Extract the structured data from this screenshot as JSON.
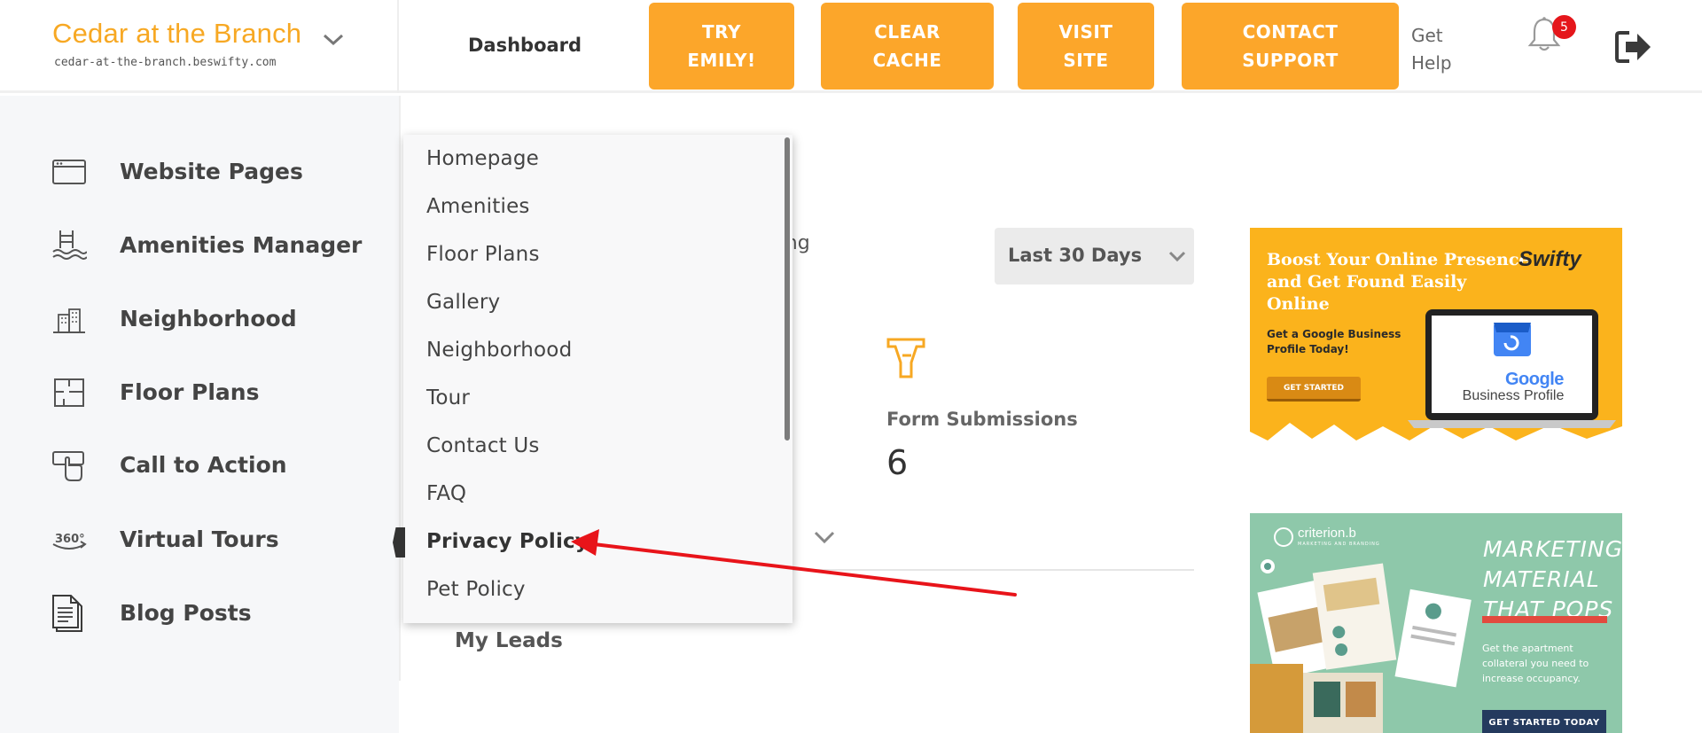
{
  "header": {
    "site_title": "Cedar at the Branch",
    "site_url": "cedar-at-the-branch.beswifty.com",
    "nav_dashboard": "Dashboard",
    "buttons": [
      {
        "line1": "TRY",
        "line2": "EMILY!"
      },
      {
        "line1": "CLEAR",
        "line2": "CACHE"
      },
      {
        "line1": "VISIT",
        "line2": "SITE"
      },
      {
        "line1": "CONTACT",
        "line2": "SUPPORT"
      }
    ],
    "get_help": "Get Help",
    "notification_count": "5",
    "accent_color": "#fca62a",
    "badge_color": "#e5161b"
  },
  "sidebar": {
    "items": [
      {
        "label": "Website Pages",
        "icon": "browser-window-icon"
      },
      {
        "label": "Amenities Manager",
        "icon": "pool-ladder-icon"
      },
      {
        "label": "Neighborhood",
        "icon": "buildings-icon"
      },
      {
        "label": "Floor Plans",
        "icon": "floor-plan-icon"
      },
      {
        "label": "Call to Action",
        "icon": "hand-pointer-icon"
      },
      {
        "label": "Virtual Tours",
        "icon": "360-view-icon"
      },
      {
        "label": "Blog Posts",
        "icon": "document-icon"
      }
    ]
  },
  "pages_menu": {
    "items": [
      "Homepage",
      "Amenities",
      "Floor Plans",
      "Gallery",
      "Neighborhood",
      "Tour",
      "Contact Us",
      "FAQ",
      "Privacy Policy",
      "Pet Policy"
    ],
    "active": "Privacy Policy"
  },
  "main": {
    "partial_text": "rting",
    "date_range": "Last 30 Days",
    "form_submissions_label": "Form Submissions",
    "form_submissions_value": "6",
    "my_leads": "My Leads"
  },
  "ads": {
    "google": {
      "headline": "Boost Your Online Presence and Get Found Easily Online",
      "subtext": "Get a Google Business Profile Today!",
      "cta": "GET STARTED",
      "brand": "Swifty",
      "product_google": "Google",
      "product_name": "Business Profile",
      "bg_color": "#fbb31c"
    },
    "criterion": {
      "logo": "criterion.b",
      "logo_tag": "MARKETING AND BRANDING",
      "headline_1": "MARKETING",
      "headline_2": "MATERIAL",
      "headline_3": "THAT POPS",
      "description": "Get the apartment collateral you need to increase occupancy.",
      "cta": "GET STARTED TODAY",
      "bg_color": "#8ec8aa"
    }
  }
}
